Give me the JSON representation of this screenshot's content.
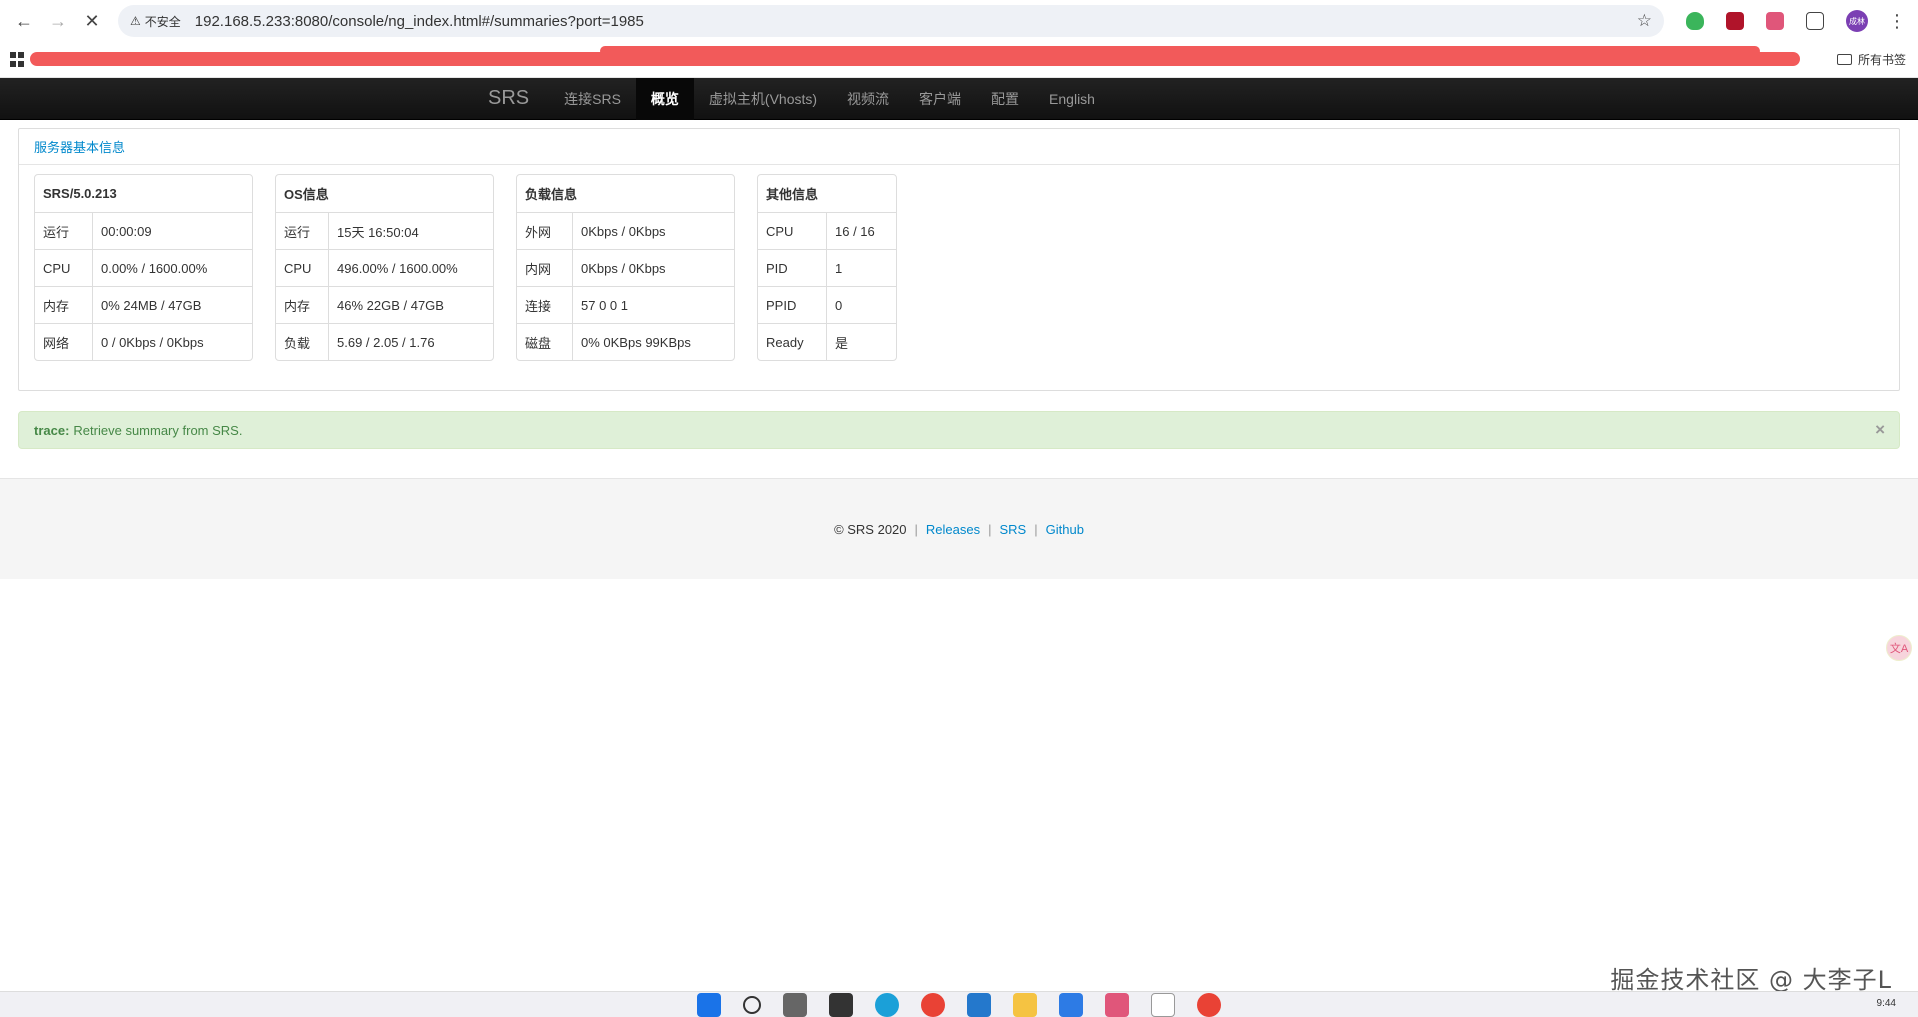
{
  "browser": {
    "insecure_label": "不安全",
    "url": "192.168.5.233:8080/console/ng_index.html#/summaries?port=1985",
    "bookmarks_folder": "所有书签",
    "profile": "成林"
  },
  "nav": {
    "brand": "SRS",
    "items": [
      {
        "label": "连接SRS",
        "active": false
      },
      {
        "label": "概览",
        "active": true
      },
      {
        "label": "虚拟主机(Vhosts)",
        "active": false
      },
      {
        "label": "视频流",
        "active": false
      },
      {
        "label": "客户端",
        "active": false
      },
      {
        "label": "配置",
        "active": false
      },
      {
        "label": "English",
        "active": false
      }
    ]
  },
  "panel": {
    "title": "服务器基本信息"
  },
  "tables": {
    "srs": {
      "title": "SRS/5.0.213",
      "rows": [
        {
          "k": "运行",
          "v": "00:00:09"
        },
        {
          "k": "CPU",
          "v": "0.00% / 1600.00%"
        },
        {
          "k": "内存",
          "v": "0% 24MB / 47GB"
        },
        {
          "k": "网络",
          "v": "0 / 0Kbps / 0Kbps"
        }
      ]
    },
    "os": {
      "title": "OS信息",
      "rows": [
        {
          "k": "运行",
          "v": "15天 16:50:04"
        },
        {
          "k": "CPU",
          "v": "496.00% / 1600.00%"
        },
        {
          "k": "内存",
          "v": "46% 22GB / 47GB"
        },
        {
          "k": "负载",
          "v": "5.69 / 2.05 / 1.76"
        }
      ]
    },
    "load": {
      "title": "负载信息",
      "rows": [
        {
          "k": "外网",
          "v": "0Kbps / 0Kbps"
        },
        {
          "k": "内网",
          "v": "0Kbps / 0Kbps"
        },
        {
          "k": "连接",
          "v": "57 0 0 1"
        },
        {
          "k": "磁盘",
          "v": "0% 0KBps 99KBps"
        }
      ]
    },
    "other": {
      "title": "其他信息",
      "rows": [
        {
          "k": "CPU",
          "v": "16 / 16"
        },
        {
          "k": "PID",
          "v": "1"
        },
        {
          "k": "PPID",
          "v": "0"
        },
        {
          "k": "Ready",
          "v": "是"
        }
      ]
    }
  },
  "alert": {
    "label": "trace:",
    "message": "Retrieve summary from SRS.",
    "close": "×"
  },
  "footer": {
    "copyright": "© SRS 2020",
    "links": [
      "Releases",
      "SRS",
      "Github"
    ],
    "separator": "|"
  },
  "watermark": "掘金技术社区 @ 大李子L",
  "taskbar": {
    "time": "9:44"
  },
  "colors": {
    "link": "#0088cc",
    "alert_bg": "#dff0d8",
    "alert_text": "#468847",
    "navbar_bg": "#1b1b1b",
    "redaction": "#f25a5a"
  }
}
